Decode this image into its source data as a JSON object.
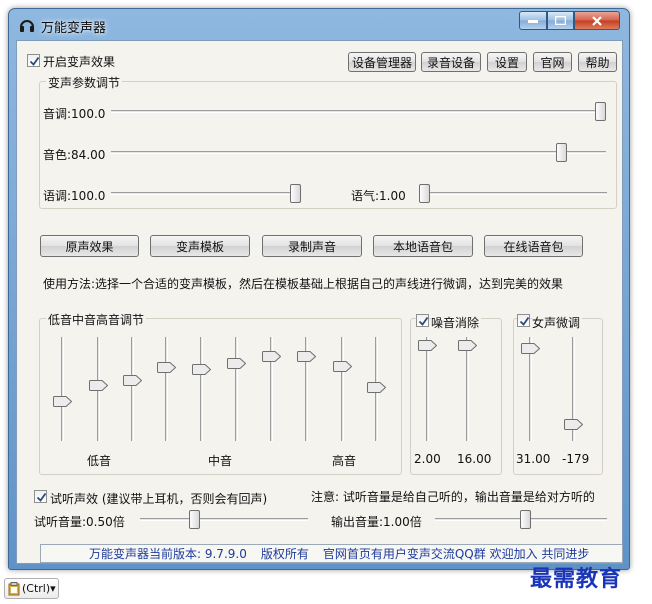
{
  "window": {
    "title": "万能变声器"
  },
  "top": {
    "enable_label": "开启变声效果",
    "enable_checked": true,
    "buttons": [
      "设备管理器",
      "录音设备",
      "设置",
      "官网",
      "帮助"
    ]
  },
  "params": {
    "group_title": "变声参数调节",
    "pitch_label": "音调:100.0",
    "pitch_level": 1.0,
    "timbre_label": "音色:84.00",
    "timbre_level": 0.92,
    "tone_label": "语调:100.0",
    "tone_level": 1.0,
    "breath_label": "语气:1.00",
    "breath_level": 0.0
  },
  "effects": {
    "buttons": [
      "原声效果",
      "变声模板",
      "录制声音",
      "本地语音包",
      "在线语音包"
    ],
    "usage_text": "使用方法:选择一个合适的变声模板，然后在模板基础上根据自己的声线进行微调，达到完美的效果"
  },
  "eq": {
    "group_title": "低音中音高音调节",
    "levels": [
      0.62,
      0.46,
      0.41,
      0.29,
      0.31,
      0.25,
      0.18,
      0.18,
      0.28,
      0.48
    ],
    "low_label": "低音",
    "mid_label": "中音",
    "high_label": "高音"
  },
  "noise": {
    "label": "噪音消除",
    "checked": true,
    "left_value": "2.00",
    "right_value": "16.00"
  },
  "female": {
    "label": "女声微调",
    "checked": true,
    "left_value": "31.00",
    "right_value": "-179"
  },
  "monitor": {
    "label": "试听声效 (建议带上耳机，否则会有回声)",
    "checked": true,
    "note": "注意: 试听音量是给自己听的，输出音量是给对方听的",
    "listen_label": "试听音量:0.50倍",
    "listen_level": 0.31,
    "output_label": "输出音量:1.00倍",
    "output_level": 0.53
  },
  "status": {
    "version": "万能变声器当前版本: 9.7.9.0",
    "rights": "版权所有",
    "homepage": "官网首页有用户变声交流QQ群 欢迎加入 共同进步"
  },
  "taskbar": {
    "ctrl_label": "(Ctrl)▾"
  },
  "watermark": "最需教育"
}
